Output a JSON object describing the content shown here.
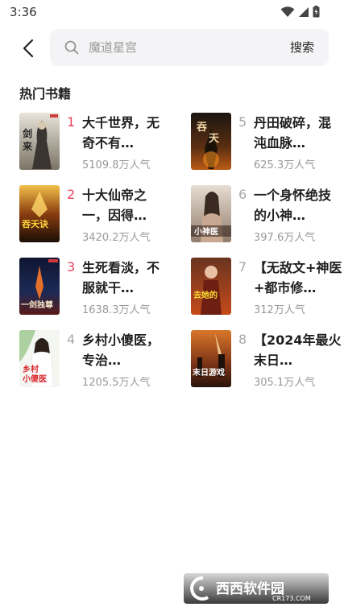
{
  "status_bar": {
    "time": "3:36"
  },
  "search": {
    "placeholder": "魔道星宫",
    "button_label": "搜索"
  },
  "section_title": "热门书籍",
  "colors": {
    "rank_top": "#e8435f",
    "rank_other": "#a8a8a8",
    "accent": "#e8435f"
  },
  "books": [
    {
      "rank": "1",
      "title": "大千世界，无奇不有…",
      "popularity": "5109.8万人气",
      "cover_text": "剑来"
    },
    {
      "rank": "5",
      "title": "丹田破碎，混沌血脉…",
      "popularity": "625.3万人气",
      "cover_text": "吞天"
    },
    {
      "rank": "2",
      "title": "十大仙帝之一，因得…",
      "popularity": "3420.2万人气",
      "cover_text": "吞天诀"
    },
    {
      "rank": "6",
      "title": "一个身怀绝技的小神…",
      "popularity": "397.6万人气",
      "cover_text": "小神医"
    },
    {
      "rank": "3",
      "title": "生死看淡，不服就干…",
      "popularity": "1638.3万人气",
      "cover_text": "一剑独尊"
    },
    {
      "rank": "7",
      "title": "【无敌文+神医+都市修…",
      "popularity": "312万人气",
      "cover_text": "去她的"
    },
    {
      "rank": "4",
      "title": "乡村小傻医，专治…",
      "popularity": "1205.5万人气",
      "cover_text": "乡村小傻医"
    },
    {
      "rank": "8",
      "title": "【2024年最火末日…",
      "popularity": "305.1万人气",
      "cover_text": "末日游戏"
    }
  ],
  "watermark": {
    "text": "西西软件园",
    "sub": "CR173.COM"
  }
}
